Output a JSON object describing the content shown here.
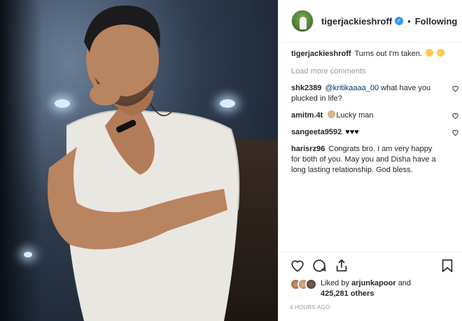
{
  "post": {
    "image_alt": "Post photo"
  },
  "header": {
    "username": "tigerjackieshroff",
    "separator": "•",
    "follow_state": "Following"
  },
  "caption": {
    "username": "tigerjackieshroff",
    "text": "Turns out I'm taken."
  },
  "load_more": "Load more comments",
  "comments": [
    {
      "username": "shk2389",
      "mention": "@kritikaaaa_00",
      "text": " what have you plucked in life?"
    },
    {
      "username": "amitm.4t",
      "text": "Lucky man"
    },
    {
      "username": "sangeeta9592",
      "text": "♥♥♥"
    },
    {
      "username": "harisrz96",
      "text": "Congrats bro. I am very happy for both of you. May you and Disha have a long lasting relationship. God bless."
    }
  ],
  "likes": {
    "prefix": "Liked by",
    "first_user": "arjunkapoor",
    "conjunction": "and",
    "others_count": "425,281 others"
  },
  "timestamp": "4 HOURS AGO",
  "icons": {
    "like": "heart-outline-icon",
    "comment": "speech-bubble-icon",
    "share": "share-upload-icon",
    "save": "bookmark-icon",
    "verified": "verified-badge-icon"
  },
  "colors": {
    "verified": "#3897f0",
    "mention": "#003569",
    "muted": "#999999",
    "text": "#262626"
  }
}
